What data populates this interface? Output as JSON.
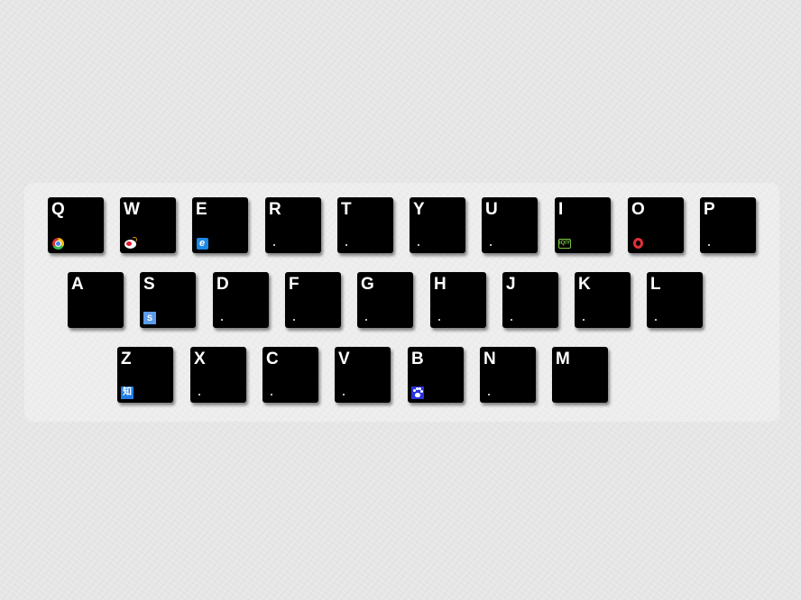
{
  "keyboard": {
    "row1": [
      {
        "letter": "Q",
        "icon": "chrome-icon"
      },
      {
        "letter": "W",
        "icon": "weibo-icon"
      },
      {
        "letter": "E",
        "icon": "ie-browser-icon"
      },
      {
        "letter": "R",
        "icon": "dot"
      },
      {
        "letter": "T",
        "icon": "dot"
      },
      {
        "letter": "Y",
        "icon": "dot"
      },
      {
        "letter": "U",
        "icon": "dot"
      },
      {
        "letter": "I",
        "icon": "iqiyi-icon"
      },
      {
        "letter": "O",
        "icon": "opera-icon"
      },
      {
        "letter": "P",
        "icon": "dot"
      }
    ],
    "row2": [
      {
        "letter": "A",
        "icon": "none"
      },
      {
        "letter": "S",
        "icon": "sogou-icon"
      },
      {
        "letter": "D",
        "icon": "dot"
      },
      {
        "letter": "F",
        "icon": "dot"
      },
      {
        "letter": "G",
        "icon": "dot"
      },
      {
        "letter": "H",
        "icon": "dot"
      },
      {
        "letter": "J",
        "icon": "dot"
      },
      {
        "letter": "K",
        "icon": "dot"
      },
      {
        "letter": "L",
        "icon": "dot"
      }
    ],
    "row3": [
      {
        "letter": "Z",
        "icon": "zhihu-icon"
      },
      {
        "letter": "X",
        "icon": "dot"
      },
      {
        "letter": "C",
        "icon": "dot"
      },
      {
        "letter": "V",
        "icon": "dot"
      },
      {
        "letter": "B",
        "icon": "baidu-icon"
      },
      {
        "letter": "N",
        "icon": "dot"
      },
      {
        "letter": "M",
        "icon": "none"
      }
    ]
  },
  "icon_text": {
    "ie": "e",
    "iqiyi": "iQIY",
    "sogou": "S",
    "zhihu": "知"
  },
  "colors": {
    "key_background": "#000000",
    "key_text": "#ffffff",
    "page_background": "#e6e6e6"
  }
}
